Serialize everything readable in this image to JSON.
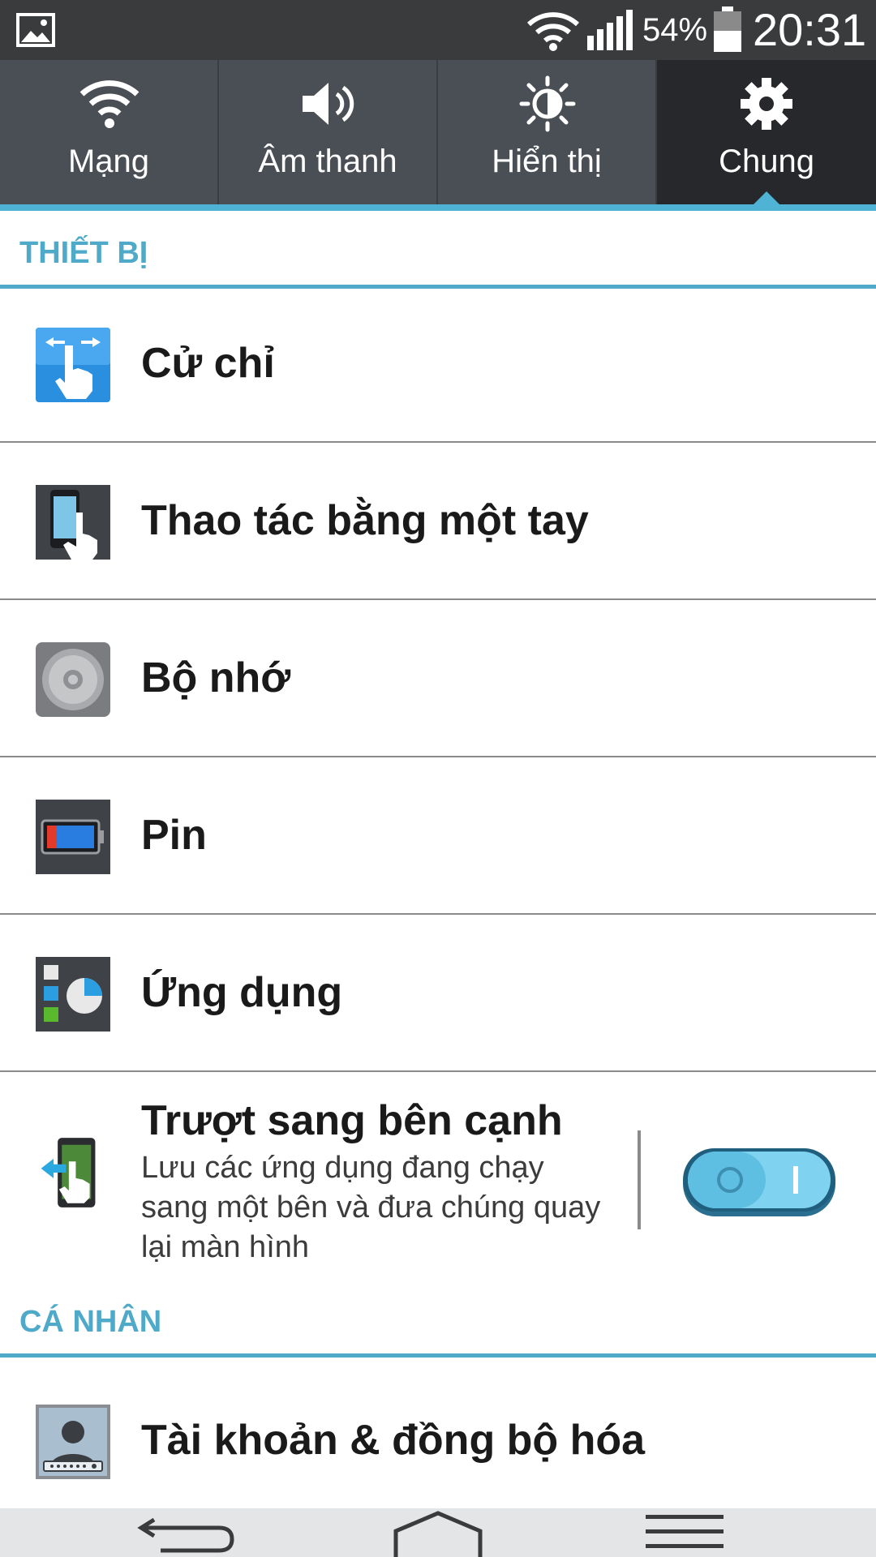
{
  "status_bar": {
    "battery_percent": "54%",
    "time": "20:31",
    "icons": [
      "gallery-icon",
      "wifi-icon",
      "signal-icon",
      "battery-icon"
    ]
  },
  "tabs": [
    {
      "label": "Mạng",
      "icon": "wifi-icon",
      "active": false
    },
    {
      "label": "Âm thanh",
      "icon": "speaker-icon",
      "active": false
    },
    {
      "label": "Hiển thị",
      "icon": "brightness-icon",
      "active": false
    },
    {
      "label": "Chung",
      "icon": "gear-icon",
      "active": true
    }
  ],
  "sections": {
    "device": {
      "title": "THIẾT BỊ",
      "items": [
        {
          "title": "Cử chỉ",
          "icon": "gesture-icon"
        },
        {
          "title": "Thao tác bằng một tay",
          "icon": "one-hand-icon"
        },
        {
          "title": "Bộ nhớ",
          "icon": "storage-icon"
        },
        {
          "title": "Pin",
          "icon": "battery-icon"
        },
        {
          "title": "Ứng dụng",
          "icon": "apps-icon"
        }
      ],
      "slide_aside": {
        "title": "Trượt sang bên cạnh",
        "subtitle": "Lưu các ứng dụng đang chạy sang một bên và đưa chúng quay lại màn hình",
        "icon": "slide-aside-icon",
        "enabled": true
      }
    },
    "personal": {
      "title": "CÁ NHÂN",
      "items": [
        {
          "title": "Tài khoản & đồng bộ hóa",
          "icon": "account-icon"
        }
      ]
    }
  },
  "nav_bar": {
    "buttons": [
      "back-icon",
      "home-icon",
      "menu-icon"
    ]
  },
  "colors": {
    "accent": "#4fb3d6",
    "section_title": "#4fa9c8",
    "tab_bg": "#4a4e55",
    "tab_active_bg": "#26282c",
    "status_bar_bg": "#3a3b3d"
  }
}
